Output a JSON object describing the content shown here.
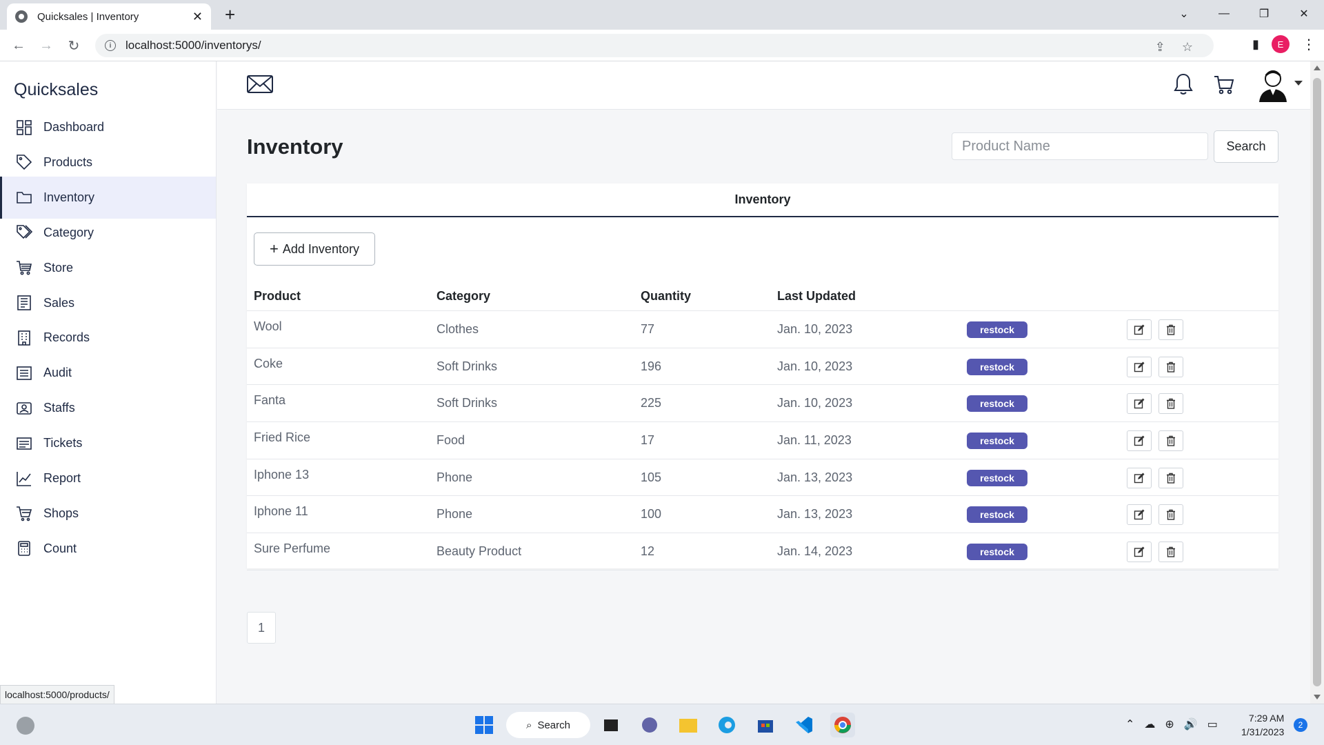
{
  "browser": {
    "tab_title": "Quicksales | Inventory",
    "tab_close": "✕",
    "new_tab": "+",
    "url": "localhost:5000/inventorys/",
    "profile_initial": "E",
    "status_url": "localhost:5000/products/"
  },
  "app": {
    "brand": "Quicksales"
  },
  "sidebar": {
    "items": [
      {
        "label": "Dashboard",
        "icon": "dashboard-icon",
        "active": false
      },
      {
        "label": "Products",
        "icon": "tag-icon",
        "active": false
      },
      {
        "label": "Inventory",
        "icon": "folder-icon",
        "active": true
      },
      {
        "label": "Category",
        "icon": "tags-icon",
        "active": false
      },
      {
        "label": "Store",
        "icon": "cart-icon",
        "active": false
      },
      {
        "label": "Sales",
        "icon": "receipt-icon",
        "active": false
      },
      {
        "label": "Records",
        "icon": "building-icon",
        "active": false
      },
      {
        "label": "Audit",
        "icon": "list-icon",
        "active": false
      },
      {
        "label": "Staffs",
        "icon": "staff-icon",
        "active": false
      },
      {
        "label": "Tickets",
        "icon": "ticket-icon",
        "active": false
      },
      {
        "label": "Report",
        "icon": "chart-icon",
        "active": false
      },
      {
        "label": "Shops",
        "icon": "shop-cart-icon",
        "active": false
      },
      {
        "label": "Count",
        "icon": "calculator-icon",
        "active": false
      }
    ]
  },
  "main": {
    "page_title": "Inventory",
    "search_placeholder": "Product Name",
    "search_label": "Search",
    "card_title": "Inventory",
    "add_label": "Add Inventory",
    "add_icon": "+",
    "columns": [
      "Product",
      "Category",
      "Quantity",
      "Last Updated"
    ],
    "rows": [
      {
        "product": "Wool",
        "category": "Clothes",
        "quantity": "77",
        "updated": "Jan. 10, 2023",
        "badge": "restock"
      },
      {
        "product": "Coke",
        "category": "Soft Drinks",
        "quantity": "196",
        "updated": "Jan. 10, 2023",
        "badge": "restock"
      },
      {
        "product": "Fanta",
        "category": "Soft Drinks",
        "quantity": "225",
        "updated": "Jan. 10, 2023",
        "badge": "restock"
      },
      {
        "product": "Fried Rice",
        "category": "Food",
        "quantity": "17",
        "updated": "Jan. 11, 2023",
        "badge": "restock"
      },
      {
        "product": "Iphone 13",
        "category": "Phone",
        "quantity": "105",
        "updated": "Jan. 13, 2023",
        "badge": "restock"
      },
      {
        "product": "Iphone 11",
        "category": "Phone",
        "quantity": "100",
        "updated": "Jan. 13, 2023",
        "badge": "restock"
      },
      {
        "product": "Sure Perfume",
        "category": "Beauty Product",
        "quantity": "12",
        "updated": "Jan. 14, 2023",
        "badge": "restock"
      }
    ],
    "pagination": [
      "1"
    ]
  },
  "taskbar": {
    "search_label": "Search",
    "time": "7:29 AM",
    "date": "1/31/2023",
    "notification_count": "2"
  },
  "colors": {
    "brand_dark": "#1f2a44",
    "badge": "#5557b0",
    "active_bg": "#eceefb"
  }
}
